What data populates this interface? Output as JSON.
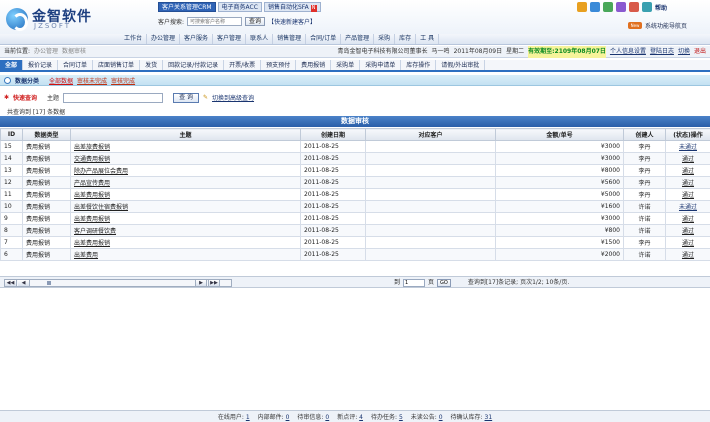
{
  "header": {
    "logo_text": "金智软件",
    "logo_sub": "JZSOFT",
    "product_tabs": [
      {
        "label": "客户关系管理CRM",
        "active": true
      },
      {
        "label": "电子商务ACC",
        "active": false
      },
      {
        "label": "销售自动化SFA",
        "active": false
      }
    ],
    "search_label": "客户搜索:",
    "search_placeholder": "可搜索客户名称",
    "search_button": "查询",
    "quick_create": "【快速新建客户】",
    "help_label": "帮助",
    "nav_help_badge": "New",
    "nav_help_label": "系统功能导航页"
  },
  "menu": [
    "工作台",
    "办公管理",
    "客户服务",
    "客户管理",
    "联系人",
    "销售管理",
    "合同/订单",
    "产品管理",
    "采购",
    "库存",
    "工 具"
  ],
  "location": {
    "label": "当前位置:",
    "crumbs": [
      "办公管理",
      "数据审核"
    ],
    "company": "青岛金智电子科技有限公司董事长",
    "user": "马一鸣",
    "date": "2011年08月09日",
    "weekday": "星期二",
    "expire": "有效期至:2109年08月07日",
    "personal_settings": "个人信息设置",
    "login_log": "登陆日志",
    "switch": "切换",
    "logout": "退出"
  },
  "subtabs": [
    {
      "label": "全部",
      "active": true
    },
    {
      "label": "报价记录",
      "active": false
    },
    {
      "label": "合同订单",
      "active": false
    },
    {
      "label": "店面销售订单",
      "active": false
    },
    {
      "label": "发货",
      "active": false
    },
    {
      "label": "回款记录/付款记录",
      "active": false
    },
    {
      "label": "开票/收票",
      "active": false
    },
    {
      "label": "预支预付",
      "active": false
    },
    {
      "label": "费用报销",
      "active": false
    },
    {
      "label": "采购单",
      "active": false
    },
    {
      "label": "采购申请单",
      "active": false
    },
    {
      "label": "库存操作",
      "active": false
    },
    {
      "label": "请假/外出审批",
      "active": false
    }
  ],
  "category": {
    "title": "数据分类",
    "items": [
      "全部数据",
      "审核未完成",
      "审核完成"
    ]
  },
  "query": {
    "title": "快速查询",
    "field_label": "主题",
    "button": "查 询",
    "advanced": "切换到高级查询",
    "count_text": "共查询到 [17] 条数据"
  },
  "table": {
    "title": "数据审核",
    "columns": [
      "ID",
      "数据类型",
      "主题",
      "创建日期",
      "对应客户",
      "金额/单号",
      "创建人",
      "(状态)操作"
    ],
    "rows": [
      {
        "id": "15",
        "type": "费用报销",
        "subject": "出差旅费报销",
        "date": "2011-08-25",
        "customer": "",
        "amount": "¥3000",
        "creator": "李丹",
        "op": "未通过",
        "status": "rejected"
      },
      {
        "id": "14",
        "type": "费用报销",
        "subject": "交通费用报销",
        "date": "2011-08-25",
        "customer": "",
        "amount": "¥3000",
        "creator": "李丹",
        "op": "通过",
        "status": "passed"
      },
      {
        "id": "13",
        "type": "费用报销",
        "subject": "除办产品展位会费用",
        "date": "2011-08-25",
        "customer": "",
        "amount": "¥8000",
        "creator": "李丹",
        "op": "通过",
        "status": "passed"
      },
      {
        "id": "12",
        "type": "费用报销",
        "subject": "产品宣传费用",
        "date": "2011-08-25",
        "customer": "",
        "amount": "¥5600",
        "creator": "李丹",
        "op": "通过",
        "status": "passed"
      },
      {
        "id": "11",
        "type": "费用报销",
        "subject": "出差费用报销",
        "date": "2011-08-25",
        "customer": "",
        "amount": "¥5000",
        "creator": "李丹",
        "op": "通过",
        "status": "passed"
      },
      {
        "id": "10",
        "type": "费用报销",
        "subject": "出差餐饮住宿费报销",
        "date": "2011-08-25",
        "customer": "",
        "amount": "¥1600",
        "creator": "许诺",
        "op": "未通过",
        "status": "rejected"
      },
      {
        "id": "9",
        "type": "费用报销",
        "subject": "出差费用报销",
        "date": "2011-08-25",
        "customer": "",
        "amount": "¥3000",
        "creator": "许诺",
        "op": "通过",
        "status": "passed"
      },
      {
        "id": "8",
        "type": "费用报销",
        "subject": "客户调研餐饮费",
        "date": "2011-08-25",
        "customer": "",
        "amount": "¥800",
        "creator": "许诺",
        "op": "通过",
        "status": "passed"
      },
      {
        "id": "7",
        "type": "费用报销",
        "subject": "出差费用报销",
        "date": "2011-08-25",
        "customer": "",
        "amount": "¥1500",
        "creator": "李丹",
        "op": "通过",
        "status": "passed"
      },
      {
        "id": "6",
        "type": "费用报销",
        "subject": "出差费用",
        "date": "2011-08-25",
        "customer": "",
        "amount": "¥2000",
        "creator": "许诺",
        "op": "通过",
        "status": "passed"
      }
    ]
  },
  "pager": {
    "goto_prefix": "到",
    "page_value": "1",
    "goto_suffix": "页",
    "go_button": "GO",
    "info": "查询到[17]条记录; 页次1/2; 10条/页."
  },
  "footer": [
    {
      "label": "在线用户:",
      "value": "1"
    },
    {
      "label": "内部邮件:",
      "value": "0"
    },
    {
      "label": "待审信息:",
      "value": "0"
    },
    {
      "label": "新点评:",
      "value": "4"
    },
    {
      "label": "待办任务:",
      "value": "5"
    },
    {
      "label": "未读公告:",
      "value": "0"
    },
    {
      "label": "待确认库存:",
      "value": "31"
    }
  ]
}
